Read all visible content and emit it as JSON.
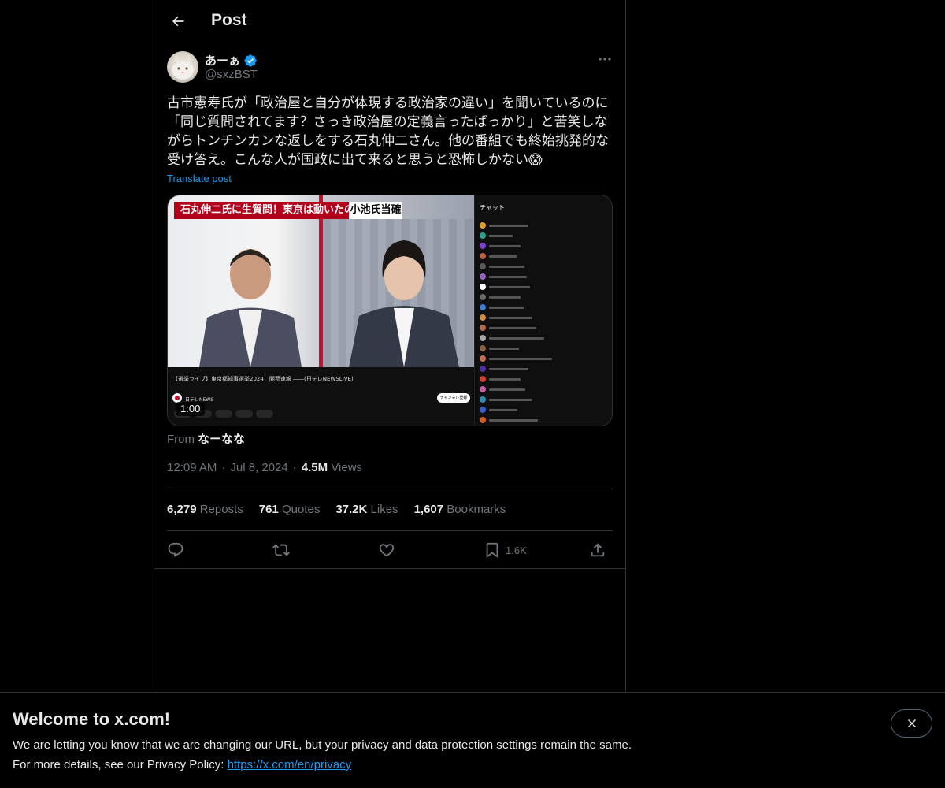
{
  "header": {
    "title": "Post"
  },
  "author": {
    "name": "あーぁ",
    "handle": "@sxzBST",
    "verified": true
  },
  "tweet": {
    "text": "古市憲寿氏が「政治屋と自分が体現する政治家の違い」を聞いているのに「同じ質問されてます？さっき政治屋の定義言ったばっかり」と苦笑しながらトンチンカンな返しをする石丸伸二さん。他の番組でも終始挑発的な受け答え。こんな人が国政に出て来ると思うと恐怖しかない😱",
    "translate_label": "Translate post"
  },
  "media": {
    "banner_text": "石丸伸二氏に生質問！東京は動いたのか",
    "banner_tag": "小池氏当確",
    "video_title": "【選挙ライブ】東京都知事選挙2024　開票速報 ――(日テレNEWSLIVE)",
    "channel": "日テレNEWS",
    "subscribe_label": "チャンネル登録",
    "chat_label": "チャット",
    "duration": "1:00"
  },
  "source": {
    "label": "From",
    "name": "なーなな"
  },
  "meta": {
    "time": "12:09 AM",
    "date": "Jul 8, 2024",
    "views_count": "4.5M",
    "views_label": "Views",
    "sep": "·"
  },
  "stats": [
    {
      "count": "6,279",
      "label": "Reposts"
    },
    {
      "count": "761",
      "label": "Quotes"
    },
    {
      "count": "37.2K",
      "label": "Likes"
    },
    {
      "count": "1,607",
      "label": "Bookmarks"
    }
  ],
  "actions": {
    "bookmark_count": "1.6K"
  },
  "cookie": {
    "title": "Welcome to x.com!",
    "line1": "We are letting you know that we are changing our URL, but your privacy and data protection settings remain the same.",
    "line2_prefix": "For more details, see our Privacy Policy: ",
    "link": "https://x.com/en/privacy"
  },
  "colors": {
    "accent": "#1d9bf0",
    "muted": "#71767b",
    "text": "#e7e9ea",
    "border": "#2f3336"
  }
}
